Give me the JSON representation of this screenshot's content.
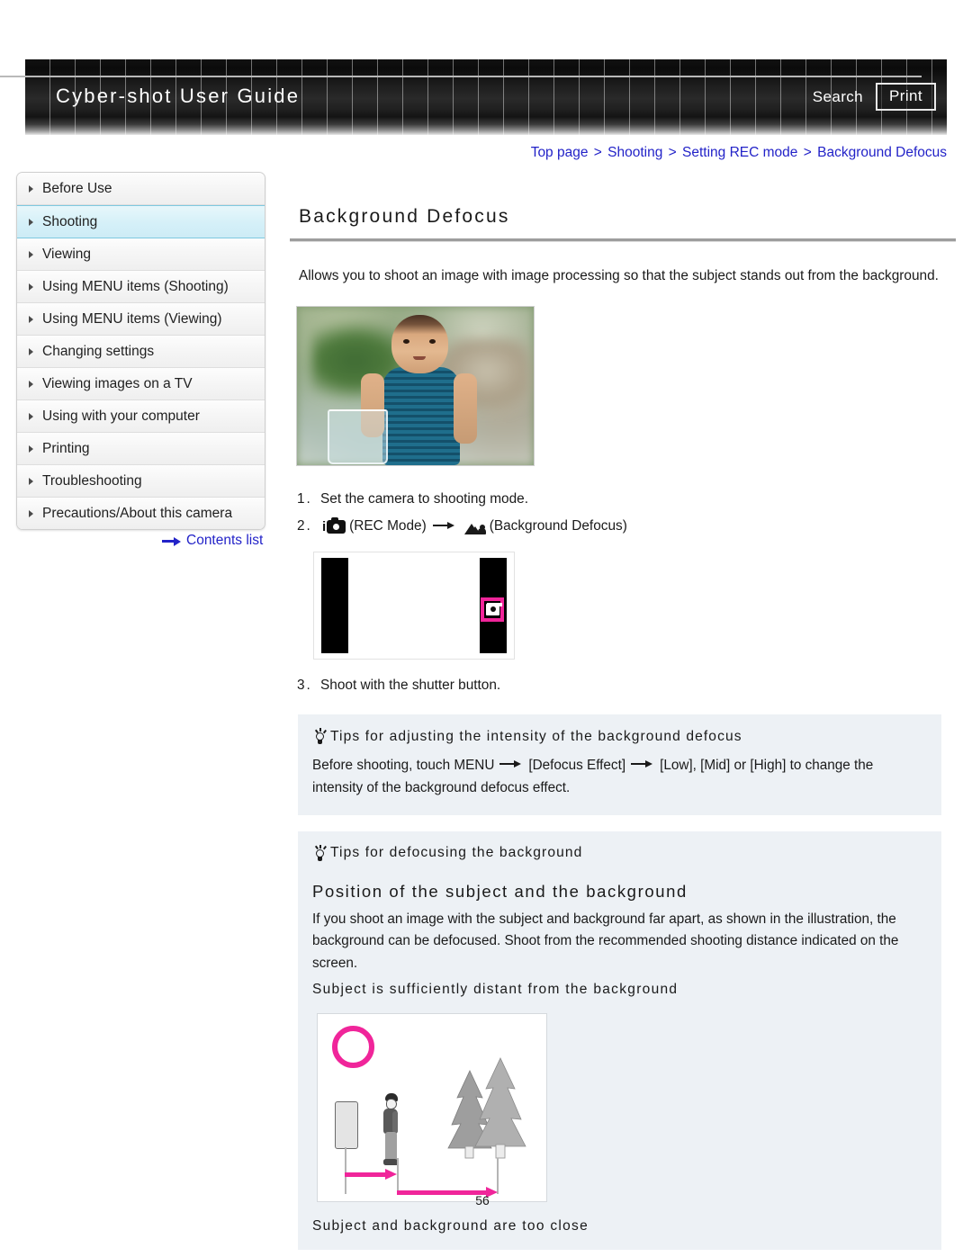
{
  "header": {
    "brand_title": "Cyber-shot User Guide",
    "search_label": "Search",
    "print_label": "Print"
  },
  "breadcrumb": {
    "items": [
      "Top page",
      "Shooting",
      "Setting REC mode",
      "Background Defocus"
    ],
    "separator": ">",
    "link_color": "#2323c8"
  },
  "sidebar": {
    "items": [
      {
        "label": "Before Use",
        "active": false
      },
      {
        "label": "Shooting",
        "active": true
      },
      {
        "label": "Viewing",
        "active": false
      },
      {
        "label": "Using MENU items (Shooting)",
        "active": false
      },
      {
        "label": "Using MENU items (Viewing)",
        "active": false
      },
      {
        "label": "Changing settings",
        "active": false
      },
      {
        "label": "Viewing images on a TV",
        "active": false
      },
      {
        "label": "Using with your computer",
        "active": false
      },
      {
        "label": "Printing",
        "active": false
      },
      {
        "label": "Troubleshooting",
        "active": false
      },
      {
        "label": "Precautions/About this camera",
        "active": false
      }
    ],
    "contents_link": "Contents list",
    "active_highlight_color": "#cdecf6"
  },
  "main": {
    "title": "Background Defocus",
    "intro": "Allows you to shoot an image with image processing so that the subject stands out from the background.",
    "steps": [
      {
        "number": "1.",
        "text": "Set the camera to shooting mode."
      },
      {
        "number": "2.",
        "icon1": "rec-mode-camera-icon",
        "label1": "(REC Mode)",
        "arrow": "→",
        "icon2": "background-defocus-icon",
        "label2": "(Background Defocus)"
      },
      {
        "number": "3.",
        "text": "Shoot with the shutter button."
      }
    ],
    "tips": [
      {
        "heading": "Tips for adjusting the intensity of the background defocus",
        "body_part1": "Before shooting, touch MENU",
        "body_part2": "[Defocus Effect]",
        "body_part3": "[Low], [Mid] or [High] to change the intensity of the background defocus effect."
      },
      {
        "heading": "Tips for defocusing the background",
        "subheading": "Position of the subject and the background",
        "body": "If you shoot an image with the subject and background far apart, as shown in the illustration, the background can be defocused. Shoot from the recommended shooting distance indicated on the screen.",
        "caption_good": "Subject is sufficiently distant from the background",
        "caption_bad": "Subject and background are too close"
      }
    ],
    "accent_pink": "#f0259a",
    "tips_bg": "#edf1f5"
  },
  "footer": {
    "page_number": "56"
  }
}
